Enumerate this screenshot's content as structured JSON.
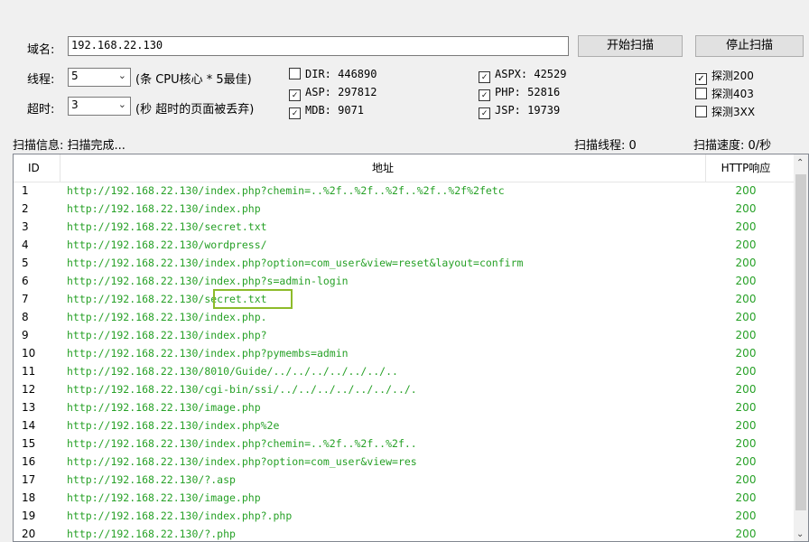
{
  "form": {
    "domain_label": "域名:",
    "domain_value": "192.168.22.130",
    "start_button": "开始扫描",
    "stop_button": "停止扫描",
    "threads_label": "线程:",
    "threads_value": "5",
    "threads_hint": "(条 CPU核心 * 5最佳)",
    "timeout_label": "超时:",
    "timeout_value": "3",
    "timeout_hint": "(秒 超时的页面被丢弃)"
  },
  "dicts": {
    "dir": {
      "label": "DIR: 446890",
      "checked": false
    },
    "asp": {
      "label": "ASP: 297812",
      "checked": true
    },
    "mdb": {
      "label": "MDB: 9071",
      "checked": true
    },
    "aspx": {
      "label": "ASPX: 42529",
      "checked": true
    },
    "php": {
      "label": "PHP: 52816",
      "checked": true
    },
    "jsp": {
      "label": "JSP: 19739",
      "checked": true
    }
  },
  "probes": {
    "p200": {
      "label": "探测200",
      "checked": true
    },
    "p403": {
      "label": "探测403",
      "checked": false
    },
    "p3xx": {
      "label": "探测3XX",
      "checked": false
    }
  },
  "status": {
    "info": "扫描信息: 扫描完成...",
    "threads": "扫描线程: 0",
    "speed": "扫描速度: 0/秒"
  },
  "table": {
    "headers": {
      "id": "ID",
      "url": "地址",
      "code": "HTTP响应"
    },
    "rows": [
      {
        "id": "1",
        "url": "http://192.168.22.130/index.php?chemin=..%2f..%2f..%2f..%2f..%2f%2fetc",
        "code": "200"
      },
      {
        "id": "2",
        "url": "http://192.168.22.130/index.php",
        "code": "200"
      },
      {
        "id": "3",
        "url": "http://192.168.22.130/secret.txt",
        "code": "200"
      },
      {
        "id": "4",
        "url": "http://192.168.22.130/wordpress/",
        "code": "200"
      },
      {
        "id": "5",
        "url": "http://192.168.22.130/index.php?option=com_user&view=reset&layout=confirm",
        "code": "200"
      },
      {
        "id": "6",
        "url": "http://192.168.22.130/index.php?s=admin-login",
        "code": "200"
      },
      {
        "id": "7",
        "url": "http://192.168.22.130/secret.txt",
        "code": "200"
      },
      {
        "id": "8",
        "url": "http://192.168.22.130/index.php.",
        "code": "200"
      },
      {
        "id": "9",
        "url": "http://192.168.22.130/index.php?",
        "code": "200"
      },
      {
        "id": "10",
        "url": "http://192.168.22.130/index.php?pymembs=admin",
        "code": "200"
      },
      {
        "id": "11",
        "url": "http://192.168.22.130/8010/Guide/../../../../../../..",
        "code": "200"
      },
      {
        "id": "12",
        "url": "http://192.168.22.130/cgi-bin/ssi/../../../../../../../.",
        "code": "200"
      },
      {
        "id": "13",
        "url": "http://192.168.22.130/image.php",
        "code": "200"
      },
      {
        "id": "14",
        "url": "http://192.168.22.130/index.php%2e",
        "code": "200"
      },
      {
        "id": "15",
        "url": "http://192.168.22.130/index.php?chemin=..%2f..%2f..%2f..",
        "code": "200"
      },
      {
        "id": "16",
        "url": "http://192.168.22.130/index.php?option=com_user&view=res",
        "code": "200"
      },
      {
        "id": "17",
        "url": "http://192.168.22.130/?.asp",
        "code": "200"
      },
      {
        "id": "18",
        "url": "http://192.168.22.130/image.php",
        "code": "200"
      },
      {
        "id": "19",
        "url": "http://192.168.22.130/index.php?.php",
        "code": "200"
      },
      {
        "id": "20",
        "url": "http://192.168.22.130/?.php",
        "code": "200"
      }
    ]
  },
  "colors": {
    "result_text": "#27a127",
    "highlight_box": "#8dbb2a"
  }
}
